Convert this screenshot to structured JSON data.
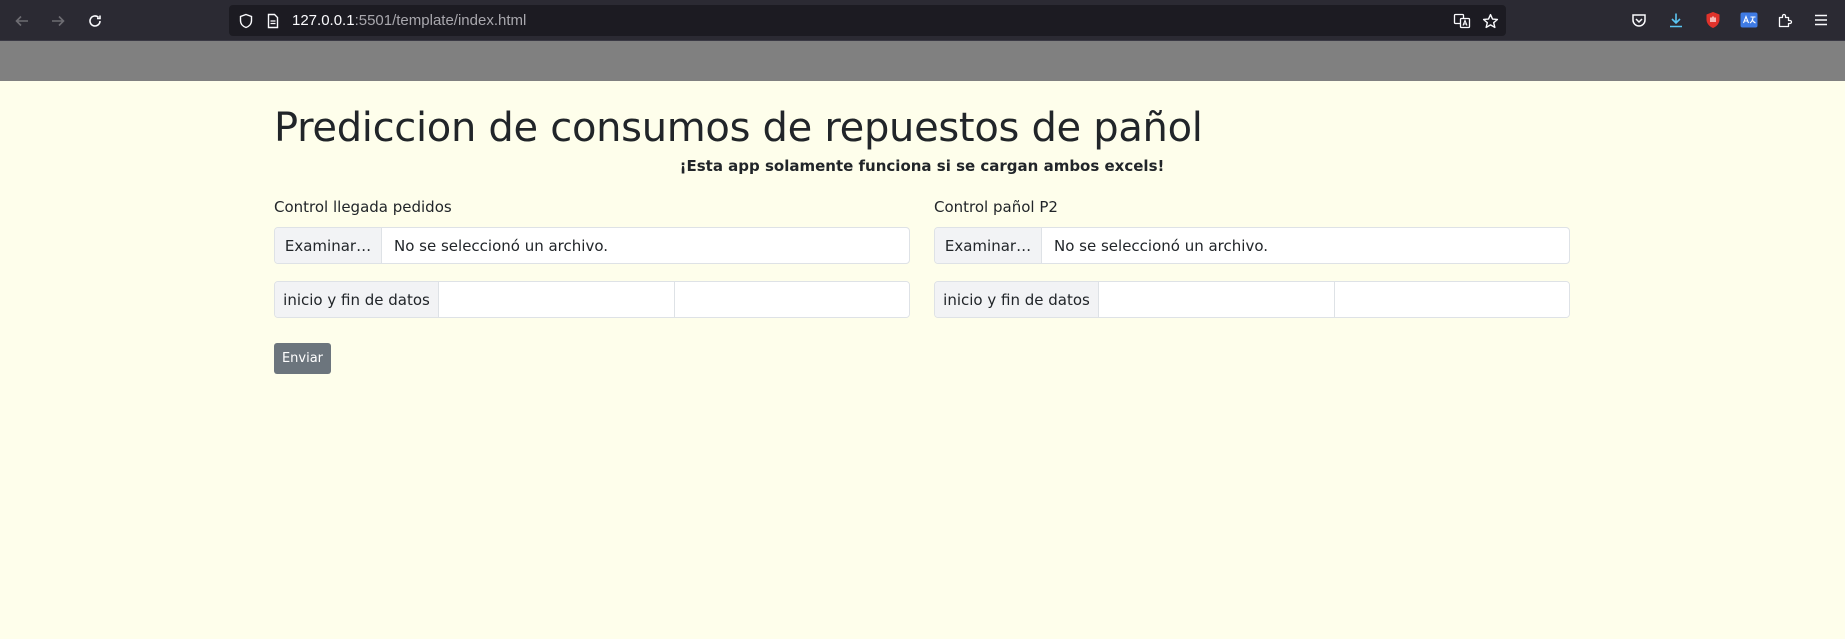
{
  "browser": {
    "url_host": "127.0.0.1",
    "url_rest": ":5501/template/index.html"
  },
  "page": {
    "title": "Prediccion de consumos de repuestos de pañol",
    "warning": "¡Esta app solamente funciona si se cargan ambos excels!"
  },
  "form": {
    "left": {
      "label": "Control llegada pedidos",
      "file_button": "Examinar…",
      "file_status": "No se seleccionó un archivo.",
      "range_label": "inicio y fin de datos",
      "range_start_value": "",
      "range_end_value": ""
    },
    "right": {
      "label": "Control pañol P2",
      "file_button": "Examinar…",
      "file_status": "No se seleccionó un archivo.",
      "range_label": "inicio y fin de datos",
      "range_start_value": "",
      "range_end_value": ""
    },
    "submit_label": "Enviar"
  },
  "icons": {
    "back": "arrow-left-icon",
    "forward": "arrow-right-icon",
    "reload": "reload-icon",
    "shield": "shield-icon",
    "page": "page-icon",
    "translate": "translate-icon",
    "bookmark": "star-icon",
    "pocket": "pocket-icon",
    "downloads": "download-icon",
    "extension_red": "ublock-icon",
    "extension_translate": "translate-extension-icon",
    "extensions": "puzzle-icon",
    "menu": "menu-icon"
  },
  "colors": {
    "page_bg": "#fefeeb",
    "header_bar": "#808080",
    "button": "#6c757d",
    "download_accent": "#5bc5f2",
    "extension_red": "#e0322b",
    "extension_blue": "#3f7be4"
  }
}
